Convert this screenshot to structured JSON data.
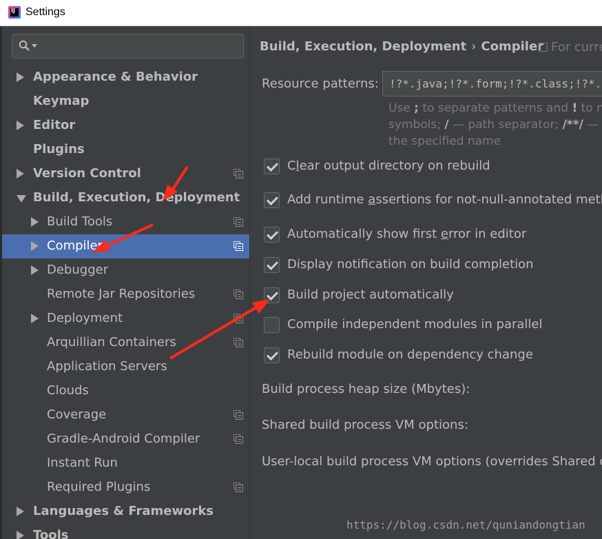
{
  "window": {
    "title": "Settings",
    "app_icon_label": "IJ"
  },
  "search": {
    "placeholder": ""
  },
  "sidebar": {
    "items": [
      {
        "label": "Appearance & Behavior",
        "arrow": "right",
        "bold": true,
        "indent": 0,
        "copy": false
      },
      {
        "label": "Keymap",
        "arrow": "none",
        "bold": true,
        "indent": 0,
        "copy": false
      },
      {
        "label": "Editor",
        "arrow": "right",
        "bold": true,
        "indent": 0,
        "copy": false
      },
      {
        "label": "Plugins",
        "arrow": "none",
        "bold": true,
        "indent": 0,
        "copy": false
      },
      {
        "label": "Version Control",
        "arrow": "right",
        "bold": true,
        "indent": 0,
        "copy": true
      },
      {
        "label": "Build, Execution, Deployment",
        "arrow": "down",
        "bold": true,
        "indent": 0,
        "copy": false
      },
      {
        "label": "Build Tools",
        "arrow": "right",
        "bold": false,
        "indent": 1,
        "copy": true
      },
      {
        "label": "Compiler",
        "arrow": "right",
        "bold": false,
        "indent": 1,
        "copy": true,
        "selected": true
      },
      {
        "label": "Debugger",
        "arrow": "right",
        "bold": false,
        "indent": 1,
        "copy": false
      },
      {
        "label": "Remote Jar Repositories",
        "arrow": "none",
        "bold": false,
        "indent": 1,
        "copy": true
      },
      {
        "label": "Deployment",
        "arrow": "right",
        "bold": false,
        "indent": 1,
        "copy": true
      },
      {
        "label": "Arquillian Containers",
        "arrow": "none",
        "bold": false,
        "indent": 1,
        "copy": true
      },
      {
        "label": "Application Servers",
        "arrow": "none",
        "bold": false,
        "indent": 1,
        "copy": false
      },
      {
        "label": "Clouds",
        "arrow": "none",
        "bold": false,
        "indent": 1,
        "copy": false
      },
      {
        "label": "Coverage",
        "arrow": "none",
        "bold": false,
        "indent": 1,
        "copy": true
      },
      {
        "label": "Gradle-Android Compiler",
        "arrow": "none",
        "bold": false,
        "indent": 1,
        "copy": true
      },
      {
        "label": "Instant Run",
        "arrow": "none",
        "bold": false,
        "indent": 1,
        "copy": false
      },
      {
        "label": "Required Plugins",
        "arrow": "none",
        "bold": false,
        "indent": 1,
        "copy": true
      },
      {
        "label": "Languages & Frameworks",
        "arrow": "right",
        "bold": true,
        "indent": 0,
        "copy": false
      },
      {
        "label": "Tools",
        "arrow": "right",
        "bold": true,
        "indent": 0,
        "copy": false
      }
    ]
  },
  "main": {
    "breadcrumb": {
      "parent": "Build, Execution, Deployment",
      "separator": "›",
      "current": "Compiler"
    },
    "scope_label": "For curre",
    "resource_patterns": {
      "label": "Resource patterns:",
      "value": "!?*.java;!?*.form;!?*.class;!?*.groovy;!?*.scala"
    },
    "hint_lines": [
      {
        "pre": "Use ",
        "b1": ";",
        "mid": " to separate patterns and ",
        "b2": "!",
        "post": " to ne"
      },
      {
        "pre": "symbols; ",
        "b1": "/",
        "mid": " — path separator; ",
        "b2": "/**/",
        "post": " — "
      },
      {
        "pre": "the specified name",
        "b1": "",
        "mid": "",
        "b2": "",
        "post": ""
      }
    ],
    "checkboxes": [
      {
        "pre": "C",
        "mn": "l",
        "post": "ear output directory on rebuild",
        "checked": true
      },
      {
        "pre": "Add runtime ",
        "mn": "a",
        "post": "ssertions for not-null-annotated metho",
        "checked": true
      },
      {
        "pre": "Automatically show first ",
        "mn": "e",
        "post": "rror in editor",
        "checked": true
      },
      {
        "pre": "Display notification on build completion",
        "mn": "",
        "post": "",
        "checked": true
      },
      {
        "pre": "Build project automatically",
        "mn": "",
        "post": "",
        "checked": true
      },
      {
        "pre": "Compile independent modules in parallel",
        "mn": "",
        "post": "",
        "checked": false
      },
      {
        "pre": "Rebuild module on dependency change",
        "mn": "",
        "post": "",
        "checked": true
      }
    ],
    "heap_label": "Build process heap size (Mbytes):",
    "shared_vm_label": "Shared build process VM options:",
    "user_vm_label": "User-local build process VM options (overrides Shared opt"
  },
  "watermark": "https://blog.csdn.net/quniandongtian",
  "colors": {
    "selection": "#4b6eaf",
    "annotation": "#ff2a1a",
    "background": "#3c3f41"
  }
}
